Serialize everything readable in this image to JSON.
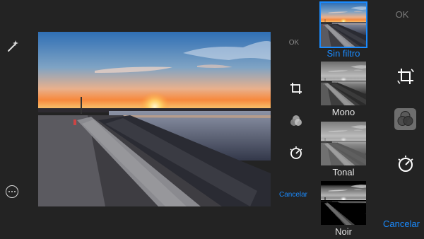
{
  "left_tools": {
    "enhance_icon": "magic-wand-icon",
    "more_icon": "more-options-icon"
  },
  "mid_toolbar": {
    "ok_label": "OK",
    "icons": [
      "crop-rotate-icon",
      "filters-icon",
      "adjust-dial-icon"
    ],
    "cancel_label": "Cancelar"
  },
  "filters": [
    {
      "label": "Sin filtro",
      "selected": true,
      "style": "color"
    },
    {
      "label": "Mono",
      "selected": false,
      "style": "mono"
    },
    {
      "label": "Tonal",
      "selected": false,
      "style": "tonal"
    },
    {
      "label": "Noir",
      "selected": false,
      "style": "noir"
    }
  ],
  "right_toolbar": {
    "ok_label": "OK",
    "icons": [
      "crop-rotate-icon",
      "filters-icon",
      "adjust-dial-icon"
    ],
    "cancel_label": "Cancelar"
  },
  "colors": {
    "accent": "#1a8bff",
    "background": "#232323"
  }
}
